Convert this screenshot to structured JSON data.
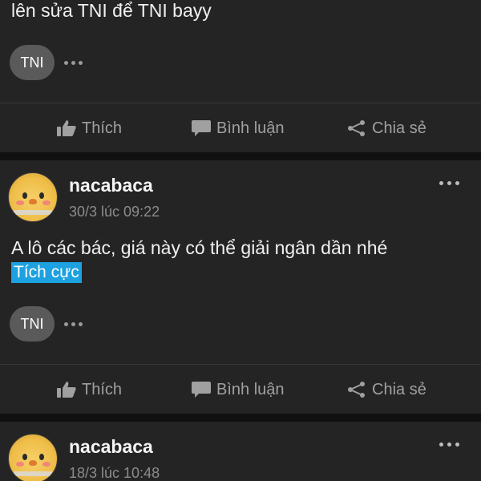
{
  "post_prev": {
    "text": "lên sửa TNI để TNI bayy",
    "ticker_tag": "TNI"
  },
  "actions": {
    "like_label": "Thích",
    "comment_label": "Bình luận",
    "share_label": "Chia sẻ"
  },
  "post_main": {
    "username": "nacabaca",
    "timestamp": "30/3 lúc 09:22",
    "text": "A lô các bác, giá này có thể giải ngân dần nhé",
    "sentiment": "Tích cực",
    "ticker_tag": "TNI"
  },
  "post_next": {
    "username": "nacabaca",
    "timestamp": "18/3 lúc 10:48"
  },
  "colors": {
    "background": "#111111",
    "card": "#242424",
    "sentiment_highlight": "#1da1e0",
    "tag_bubble": "#5a5a5a"
  }
}
